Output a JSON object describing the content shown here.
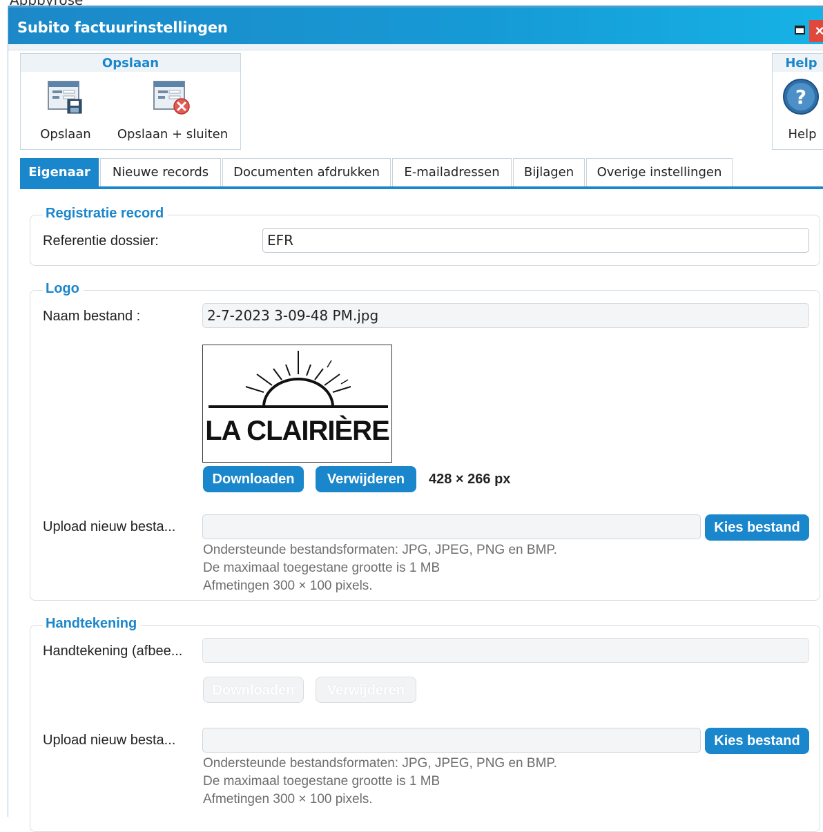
{
  "background_label": "Appbyrose",
  "window": {
    "title": "Subito factuurinstellingen",
    "close_glyph": "×"
  },
  "ribbon": {
    "save_group": {
      "header": "Opslaan",
      "buttons": [
        {
          "label": "Opslaan",
          "icon": "save-form-icon"
        },
        {
          "label": "Opslaan + sluiten",
          "icon": "save-close-form-icon"
        }
      ]
    },
    "help_group": {
      "header": "Help",
      "button": {
        "label": "Help",
        "icon": "help-icon",
        "glyph": "?"
      }
    }
  },
  "tabs": [
    {
      "label": "Eigenaar",
      "active": true
    },
    {
      "label": "Nieuwe records",
      "active": false
    },
    {
      "label": "Documenten afdrukken",
      "active": false
    },
    {
      "label": "E-mailadressen",
      "active": false
    },
    {
      "label": "Bijlagen",
      "active": false
    },
    {
      "label": "Overige instellingen",
      "active": false
    }
  ],
  "registratie": {
    "legend": "Registratie record",
    "referentie_label": "Referentie dossier:",
    "referentie_value": "EFR"
  },
  "logo": {
    "legend": "Logo",
    "filename_label": "Naam bestand :",
    "filename_value": "2-7-2023 3-09-48 PM.jpg",
    "image_text": "LA CLAIRIÈRE",
    "download_label": "Downloaden",
    "delete_label": "Verwijderen",
    "dimensions": "428 × 266 px",
    "upload_label": "Upload nieuw besta...",
    "choose_label": "Kies bestand",
    "hint_formats": "Ondersteunde bestandsformaten: JPG, JPEG, PNG en BMP.",
    "hint_size": "De maximaal toegestane grootte is 1 MB",
    "hint_dims": "Afmetingen 300 × 100 pixels."
  },
  "handtekening": {
    "legend": "Handtekening",
    "image_label": "Handtekening (afbee...",
    "download_label": "Downloaden",
    "delete_label": "Verwijderen",
    "upload_label": "Upload nieuw besta...",
    "choose_label": "Kies bestand",
    "hint_formats": "Ondersteunde bestandsformaten: JPG, JPEG, PNG en BMP.",
    "hint_size": "De maximaal toegestane grootte is 1 MB",
    "hint_dims": "Afmetingen 300 × 100 pixels."
  },
  "colors": {
    "accent": "#1a86cc",
    "title_gradient_start": "#1c88c8",
    "title_gradient_end": "#16b3e6",
    "close": "#e0483e"
  }
}
